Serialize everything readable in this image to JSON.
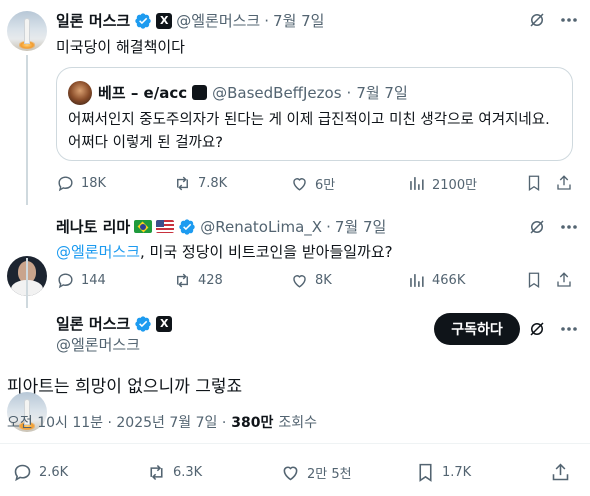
{
  "tweet1": {
    "name": "일론 머스크",
    "handle": "@엘론머스크",
    "dot": "·",
    "date": "7월 7일",
    "text": "미국당이 해결책이다",
    "badge": "X"
  },
  "quote": {
    "name": "베프 – e/acc",
    "handle": "@BasedBeffJezos",
    "dot": "·",
    "date": "7월 7일",
    "line1": "어쩌서인지 중도주의자가 된다는 게 이제 급진적이고 미친 생각으로 여겨지네요.",
    "line2": "어쩌다 이렇게 된 걸까요?"
  },
  "tweet1_actions": {
    "replies": "18K",
    "retweets": "7.8K",
    "likes": "6만",
    "views": "2100만"
  },
  "tweet2": {
    "name": "레나토 리마",
    "handle": "@RenatoLima_X",
    "dot": "·",
    "date": "7월 7일",
    "mention": "@엘론머스크",
    "text": ", 미국 정당이 비트코인을 받아들일까요?"
  },
  "tweet2_actions": {
    "replies": "144",
    "retweets": "428",
    "likes": "8K",
    "views": "466K"
  },
  "main": {
    "name": "일론 머스크",
    "handle": "@엘론머스크",
    "badge": "X",
    "subscribe_label": "구독하다",
    "text": "피아트는 희망이 없으니까 그렇죠",
    "time": "오전 10시 11분 · 2025년 7월 7일 ·",
    "views_count": "380만",
    "views_label": "조회수"
  },
  "main_actions": {
    "replies": "2.6K",
    "retweets": "6.3K",
    "likes": "2만 5천",
    "bookmarks": "1.7K"
  }
}
